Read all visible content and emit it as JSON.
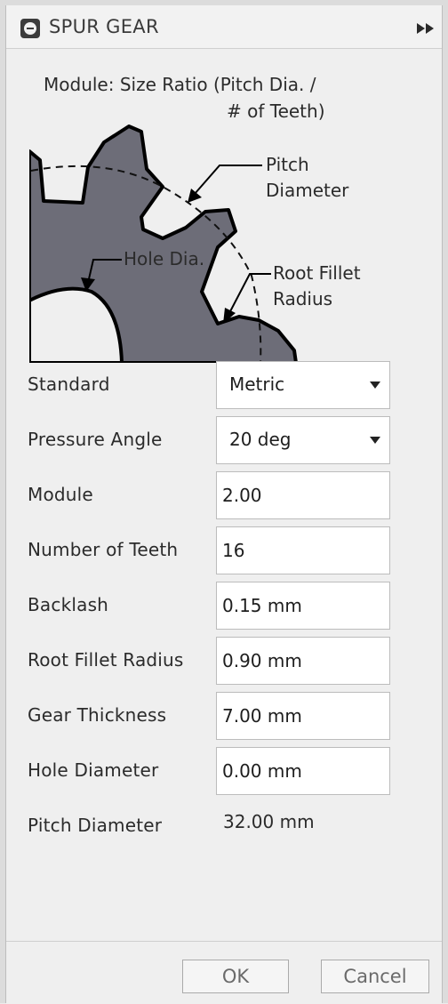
{
  "dialog": {
    "title": "SPUR GEAR",
    "collapse_icon": "minus-circle-icon",
    "expand_icon": "double-chevron-right-icon"
  },
  "diagram": {
    "caption_line1": "Module: Size Ratio (Pitch Dia. /",
    "caption_line2": "# of Teeth)",
    "label_pitch_line1": "Pitch",
    "label_pitch_line2": "Diameter",
    "label_hole": "Hole Dia.",
    "label_fillet_line1": "Root Fillet",
    "label_fillet_line2": "Radius",
    "gear_color": "#6d6d78"
  },
  "form": {
    "standard": {
      "label": "Standard",
      "value": "Metric"
    },
    "pressure_angle": {
      "label": "Pressure Angle",
      "value": "20 deg"
    },
    "module": {
      "label": "Module",
      "value": "2.00"
    },
    "teeth": {
      "label": "Number of Teeth",
      "value": "16"
    },
    "backlash": {
      "label": "Backlash",
      "value": "0.15 mm"
    },
    "root_fillet": {
      "label": "Root Fillet Radius",
      "value": "0.90 mm"
    },
    "thickness": {
      "label": "Gear Thickness",
      "value": "7.00 mm"
    },
    "hole": {
      "label": "Hole Diameter",
      "value": "0.00 mm"
    },
    "pitch_diameter": {
      "label": "Pitch Diameter",
      "value": "32.00 mm"
    }
  },
  "footer": {
    "ok_label": "OK",
    "cancel_label": "Cancel"
  }
}
